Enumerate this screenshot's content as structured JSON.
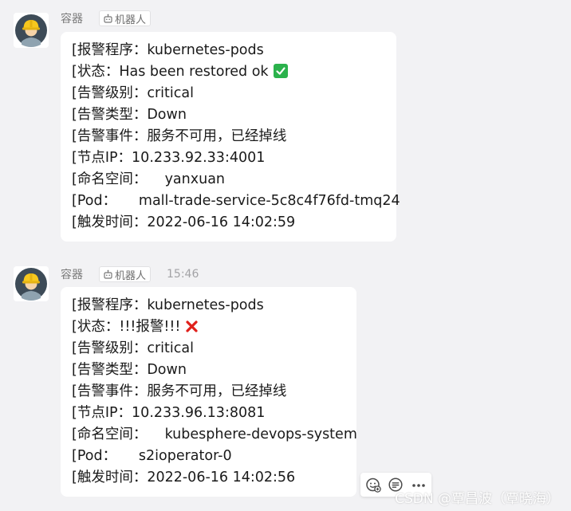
{
  "messages": [
    {
      "sender": "容器",
      "tag": "机器人",
      "time": "",
      "status_icon": "check-mark-button-icon",
      "lines": [
        {
          "label": "[报警程序：",
          "value": "kubernetes-pods"
        },
        {
          "label": "[状态：",
          "value": "Has been restored ok"
        },
        {
          "label": "[告警级别：",
          "value": "critical"
        },
        {
          "label": "[告警类型：",
          "value": "Down"
        },
        {
          "label": "[告警事件：",
          "value": "服务不可用，已经掉线"
        },
        {
          "label": "[节点IP：",
          "value": "10.233.92.33:4001"
        },
        {
          "label": "[命名空间：",
          "value": "    yanxuan"
        },
        {
          "label": "[Pod：",
          "value": "     mall-trade-service-5c8c4f76fd-tmq24"
        },
        {
          "label": "[触发时间：",
          "value": "2022-06-16 14:02:59"
        }
      ]
    },
    {
      "sender": "容器",
      "tag": "机器人",
      "time": "15:46",
      "status_icon": "cross-mark-icon",
      "lines": [
        {
          "label": "[报警程序：",
          "value": "kubernetes-pods"
        },
        {
          "label": "[状态：",
          "value": "!!!报警!!!"
        },
        {
          "label": "[告警级别：",
          "value": "critical"
        },
        {
          "label": "[告警类型：",
          "value": "Down"
        },
        {
          "label": "[告警事件：",
          "value": "服务不可用，已经掉线"
        },
        {
          "label": "[节点IP：",
          "value": "10.233.96.13:8081"
        },
        {
          "label": "[命名空间：",
          "value": "    kubesphere-devops-system"
        },
        {
          "label": "[Pod：",
          "value": "     s2ioperator-0"
        },
        {
          "label": "[触发时间：",
          "value": "2022-06-16 14:02:56"
        }
      ]
    }
  ],
  "message_actions": [
    "emoji-reaction-icon",
    "quote-reply-icon",
    "more-options-icon"
  ],
  "watermark": "CSDN @覃昌波（覃晓海）",
  "colors": {
    "background": "#f2f2f4",
    "bubble": "#ffffff",
    "check_green": "#2bb24c",
    "cross_red": "#e0201b",
    "helmet_yellow": "#f7c81e",
    "avatar_dark": "#3d4b57"
  }
}
